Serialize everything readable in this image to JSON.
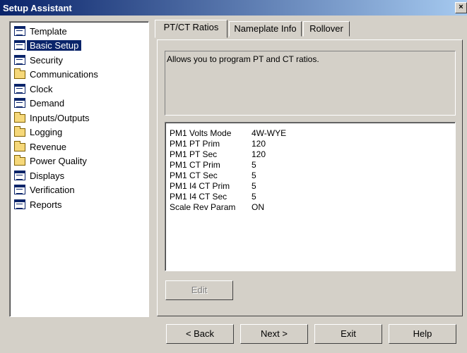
{
  "window": {
    "title": "Setup Assistant",
    "close_glyph": "×"
  },
  "sidebar": {
    "items": [
      {
        "label": "Template",
        "icon": "document-icon",
        "selected": false
      },
      {
        "label": "Basic Setup",
        "icon": "document-icon",
        "selected": true
      },
      {
        "label": "Security",
        "icon": "document-icon",
        "selected": false
      },
      {
        "label": "Communications",
        "icon": "folder-icon",
        "selected": false
      },
      {
        "label": "Clock",
        "icon": "document-icon",
        "selected": false
      },
      {
        "label": "Demand",
        "icon": "document-icon",
        "selected": false
      },
      {
        "label": "Inputs/Outputs",
        "icon": "folder-icon",
        "selected": false
      },
      {
        "label": "Logging",
        "icon": "folder-icon",
        "selected": false
      },
      {
        "label": "Revenue",
        "icon": "folder-icon",
        "selected": false
      },
      {
        "label": "Power Quality",
        "icon": "folder-icon",
        "selected": false
      },
      {
        "label": "Displays",
        "icon": "document-icon",
        "selected": false
      },
      {
        "label": "Verification",
        "icon": "document-icon",
        "selected": false
      },
      {
        "label": "Reports",
        "icon": "document-icon",
        "selected": false
      }
    ]
  },
  "tabs": [
    {
      "label": "PT/CT Ratios",
      "active": true
    },
    {
      "label": "Nameplate Info",
      "active": false
    },
    {
      "label": "Rollover",
      "active": false
    }
  ],
  "description": "Allows you to program PT and CT ratios.",
  "settings": [
    {
      "name": "PM1 Volts Mode",
      "value": "4W-WYE"
    },
    {
      "name": "PM1 PT Prim",
      "value": "120"
    },
    {
      "name": "PM1 PT Sec",
      "value": "120"
    },
    {
      "name": "PM1 CT Prim",
      "value": "5"
    },
    {
      "name": "PM1 CT Sec",
      "value": "5"
    },
    {
      "name": "PM1 I4 CT Prim",
      "value": "5"
    },
    {
      "name": "PM1 I4 CT Sec",
      "value": "5"
    },
    {
      "name": "Scale Rev Param",
      "value": "ON"
    }
  ],
  "buttons": {
    "edit": "Edit",
    "back": "< Back",
    "next": "Next >",
    "exit": "Exit",
    "help": "Help"
  }
}
